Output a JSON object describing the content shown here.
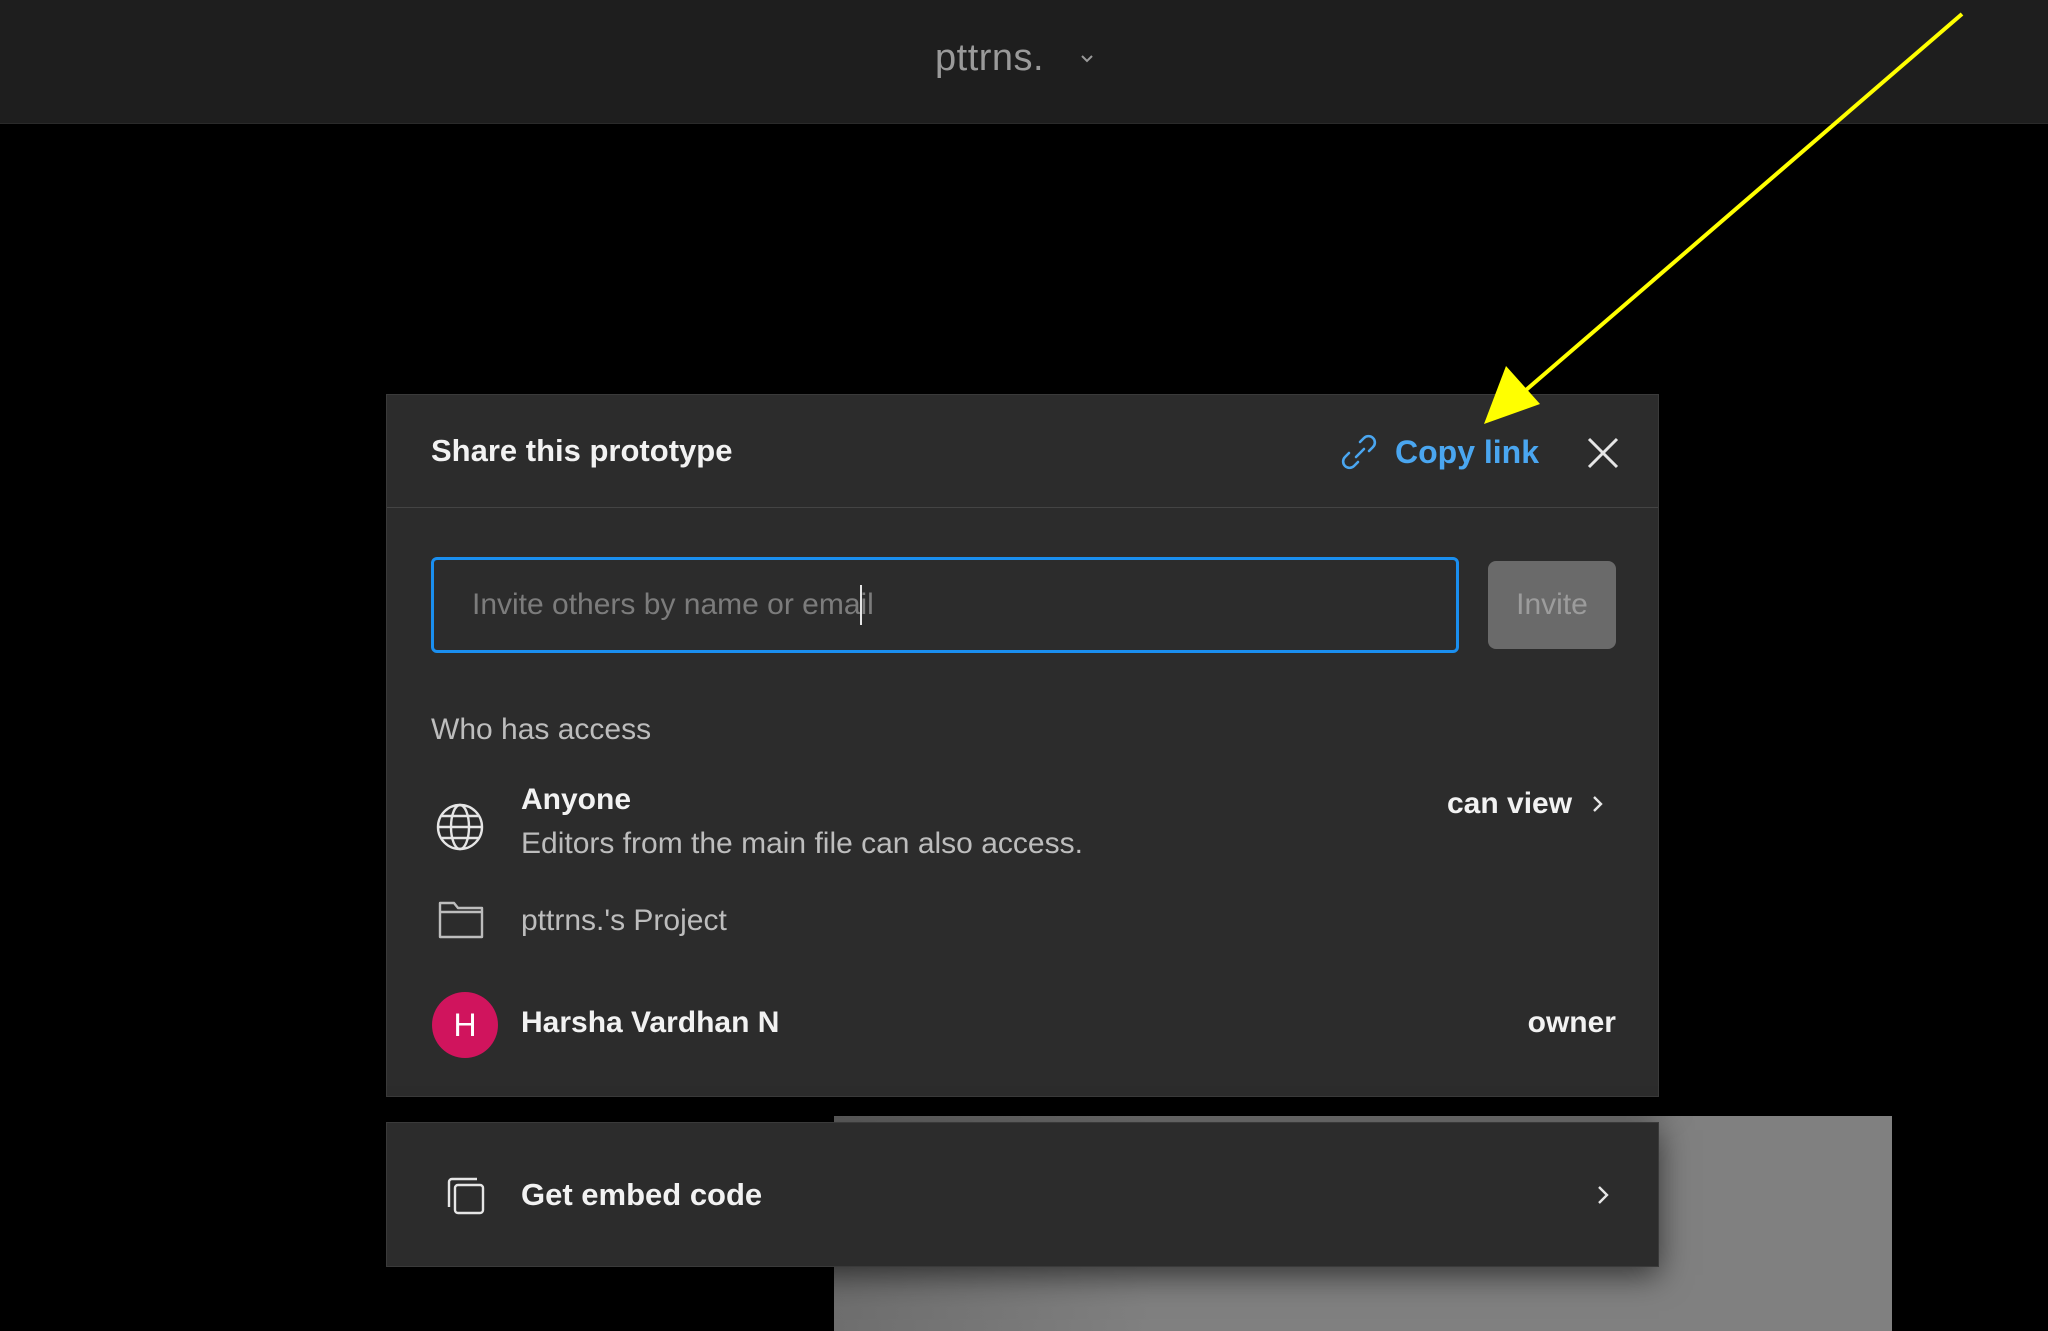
{
  "topbar": {
    "file_name": "pttrns.",
    "chevron_icon": "chevron-down-icon"
  },
  "share_dialog": {
    "title": "Share this prototype",
    "copy_link": {
      "icon": "link-icon",
      "label": "Copy link",
      "color": "#4aa6f0"
    },
    "close_icon": "close-icon",
    "invite": {
      "value": "",
      "placeholder": "Invite others by name or email",
      "button_label": "Invite"
    },
    "access_section_label": "Who has access",
    "access": [
      {
        "icon": "globe-icon",
        "title": "Anyone",
        "subtitle": "Editors from the main file can also access.",
        "permission": "can view"
      },
      {
        "icon": "folder-icon",
        "title": "pttrns.'s Project"
      },
      {
        "avatar_initial": "H",
        "avatar_color": "#d0145d",
        "title": "Harsha Vardhan N",
        "permission": "owner"
      }
    ]
  },
  "embed": {
    "icon": "copy-icon",
    "label": "Get embed code",
    "chevron_icon": "chevron-right-icon"
  },
  "colors": {
    "accent": "#1a8ff0",
    "annotation_arrow": "#ffff00",
    "dialog_bg": "#2c2c2c"
  }
}
